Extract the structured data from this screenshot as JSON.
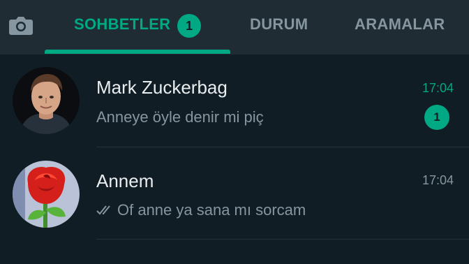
{
  "tabs": {
    "chats_label": "SOHBETLER",
    "chats_badge": "1",
    "status_label": "DURUM",
    "calls_label": "ARAMALAR"
  },
  "chats": [
    {
      "name": "Mark Zuckerbag",
      "message": "Anneye öyle denir mi piç",
      "time": "17:04",
      "unread": "1"
    },
    {
      "name": "Annem",
      "message": "Of anne ya sana mı sorcam",
      "time": "17:04",
      "status": "read-double-check-icon"
    }
  ],
  "colors": {
    "accent": "#00a884",
    "background": "#101d25",
    "header": "#1f2c34",
    "muted": "#8696a0"
  }
}
